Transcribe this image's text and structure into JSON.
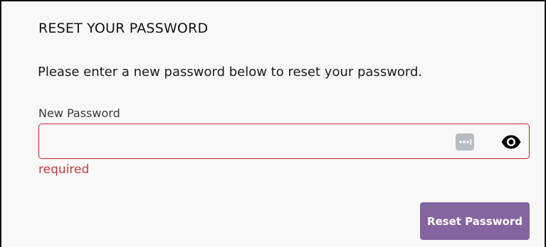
{
  "form": {
    "title": "RESET YOUR PASSWORD",
    "description": "Please enter a new password below to reset your password.",
    "password_field": {
      "label": "New Password",
      "value": "",
      "placeholder": "",
      "error": "required",
      "password_manager_icon": "password-manager-icon",
      "toggle_icon": "eye-icon"
    },
    "submit_label": "Reset Password"
  },
  "colors": {
    "background": "#f8f8f8",
    "error": "#c8242a",
    "button": "#8565a0",
    "button_text": "#ffffff"
  }
}
